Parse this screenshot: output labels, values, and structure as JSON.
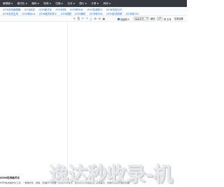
{
  "topnav": {
    "items": [
      {
        "label": "编辑器",
        "caret": true
      },
      {
        "label": "格式化",
        "caret": true
      },
      {
        "label": "编码",
        "caret": true
      },
      {
        "label": "转换",
        "caret": true
      },
      {
        "label": "压缩",
        "caret": true
      },
      {
        "label": "比对",
        "caret": true
      },
      {
        "label": "图片",
        "caret": true
      },
      {
        "label": "计算",
        "caret": true
      },
      {
        "label": "其他",
        "caret": true
      }
    ]
  },
  "tabs": {
    "row1": [
      "JSON在线编辑器",
      "JSON检查",
      "JSON格式化",
      "JSON校验",
      "JSON转XML",
      "JSON压缩转义",
      "JSON在线比对"
    ],
    "row2": [
      "JSON在线生成",
      "JSON转Java",
      "JSON格式化转义",
      "JSON视图",
      "JSON解析",
      "JSON转XML",
      "JSON在线转换",
      "JSON转CSV"
    ]
  },
  "toolbar": {
    "icons": [
      "pencil-icon",
      "copy-icon",
      "undo-icon",
      "redo-icon",
      "trash-icon",
      "expand-icon",
      "compress-icon",
      "save-icon"
    ],
    "check_1_label": "保留转义",
    "check_1_checked": true,
    "check_2_label": "引号",
    "check_2_checked": false,
    "indent_select": "缩进字符",
    "size_label": "缩进",
    "size_select": "2",
    "copy_label": "复制结果"
  },
  "description": {
    "heading": "JSON在线格式化",
    "body": "JSON在线格式化工具，一键格式化、校验、压缩JSON数据，支持JSON转义、去除转义，高亮显示，错误提示，生成JSON树形结构视图"
  },
  "watermark": "逸达秒收录-机"
}
